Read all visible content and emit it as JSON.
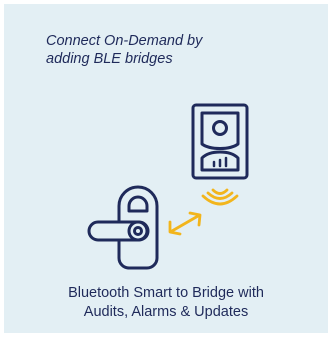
{
  "headline": {
    "line1": "Connect On-Demand by",
    "line2": "adding BLE bridges"
  },
  "caption": {
    "line1": "Bluetooth Smart to Bridge with",
    "line2": "Audits, Alarms & Updates"
  },
  "colors": {
    "background": "#e3eff4",
    "ink": "#1f2a5a",
    "accent": "#f2b51c"
  },
  "icons": {
    "bridge": "ble-bridge-icon",
    "lock": "door-lock-icon",
    "signal": "bluetooth-signal-icon",
    "link": "double-arrow-icon"
  }
}
